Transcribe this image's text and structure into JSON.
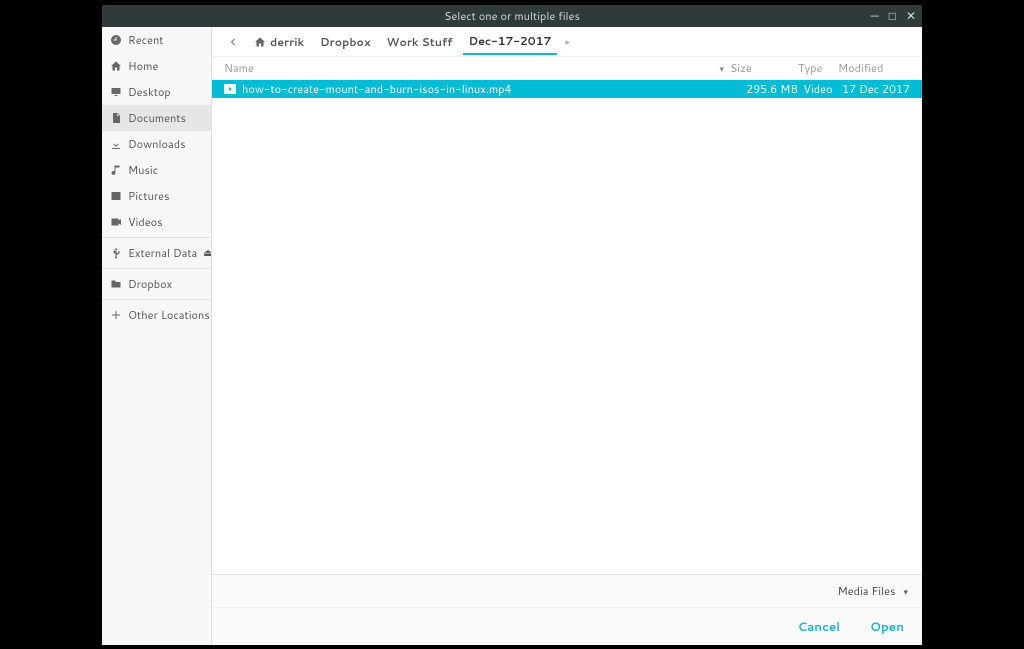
{
  "window": {
    "title": "Select one or multiple files"
  },
  "sidebar": [
    {
      "icon": "recent",
      "label": "Recent"
    },
    {
      "icon": "home",
      "label": "Home"
    },
    {
      "icon": "desktop",
      "label": "Desktop"
    },
    {
      "icon": "documents",
      "label": "Documents",
      "active": true
    },
    {
      "icon": "downloads",
      "label": "Downloads"
    },
    {
      "icon": "music",
      "label": "Music"
    },
    {
      "icon": "pictures",
      "label": "Pictures"
    },
    {
      "icon": "videos",
      "label": "Videos"
    },
    {
      "sep": true
    },
    {
      "icon": "usb",
      "label": "External Data",
      "eject": true
    },
    {
      "sep": true
    },
    {
      "icon": "folder",
      "label": "Dropbox"
    },
    {
      "sep": true
    },
    {
      "icon": "plus",
      "label": "Other Locations"
    }
  ],
  "path": {
    "crumbs": [
      {
        "label": "derrik",
        "home": true
      },
      {
        "label": "Dropbox"
      },
      {
        "label": "Work Stuff"
      },
      {
        "label": "Dec-17-2017",
        "current": true
      }
    ]
  },
  "columns": {
    "name": "Name",
    "size": "Size",
    "type": "Type",
    "modified": "Modified"
  },
  "files": [
    {
      "name": "how-to-create-mount-and-burn-isos-in-linux.mp4",
      "size": "295.6 MB",
      "type": "Video",
      "modified": "17 Dec 2017",
      "selected": true
    }
  ],
  "footer": {
    "filter": "Media Files",
    "cancel": "Cancel",
    "open": "Open"
  }
}
